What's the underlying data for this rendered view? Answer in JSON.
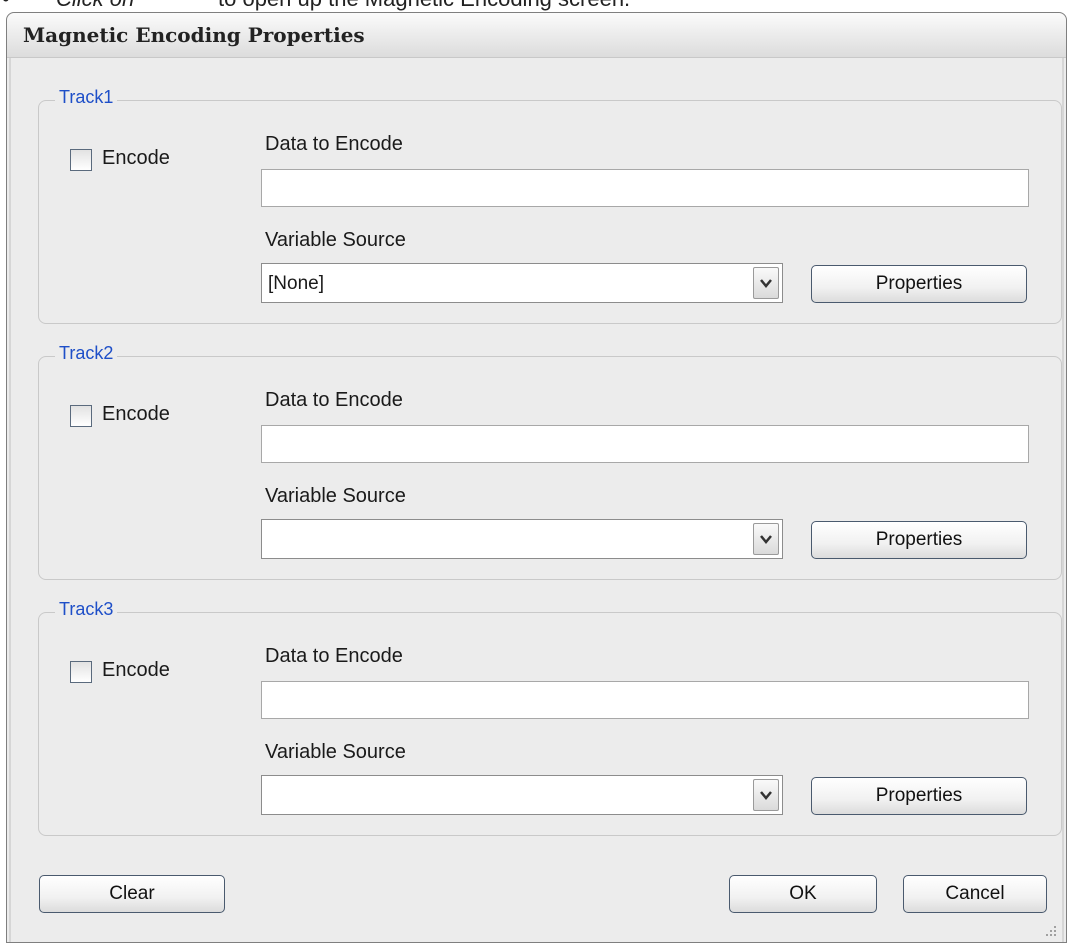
{
  "caption": {
    "bullet": "•",
    "click_word": "Click on",
    "rest": "to open up the Magnetic Encoding screen."
  },
  "dialog": {
    "title": "Magnetic Encoding Properties",
    "tracks": [
      {
        "legend": "Track1",
        "encode_label": "Encode",
        "encode_checked": false,
        "data_label": "Data to Encode",
        "data_value": "",
        "variable_label": "Variable Source",
        "variable_value": "[None]",
        "properties_label": "Properties"
      },
      {
        "legend": "Track2",
        "encode_label": "Encode",
        "encode_checked": false,
        "data_label": "Data to Encode",
        "data_value": "",
        "variable_label": "Variable Source",
        "variable_value": "",
        "properties_label": "Properties"
      },
      {
        "legend": "Track3",
        "encode_label": "Encode",
        "encode_checked": false,
        "data_label": "Data to Encode",
        "data_value": "",
        "variable_label": "Variable Source",
        "variable_value": "",
        "properties_label": "Properties"
      }
    ],
    "buttons": {
      "clear": "Clear",
      "ok": "OK",
      "cancel": "Cancel"
    }
  },
  "colors": {
    "legend": "#1e4fc8",
    "dialog_bg": "#ececec"
  },
  "icons": {
    "dropdown_arrow": "chevron-down-icon",
    "resize_grip": "resize-grip-icon"
  }
}
